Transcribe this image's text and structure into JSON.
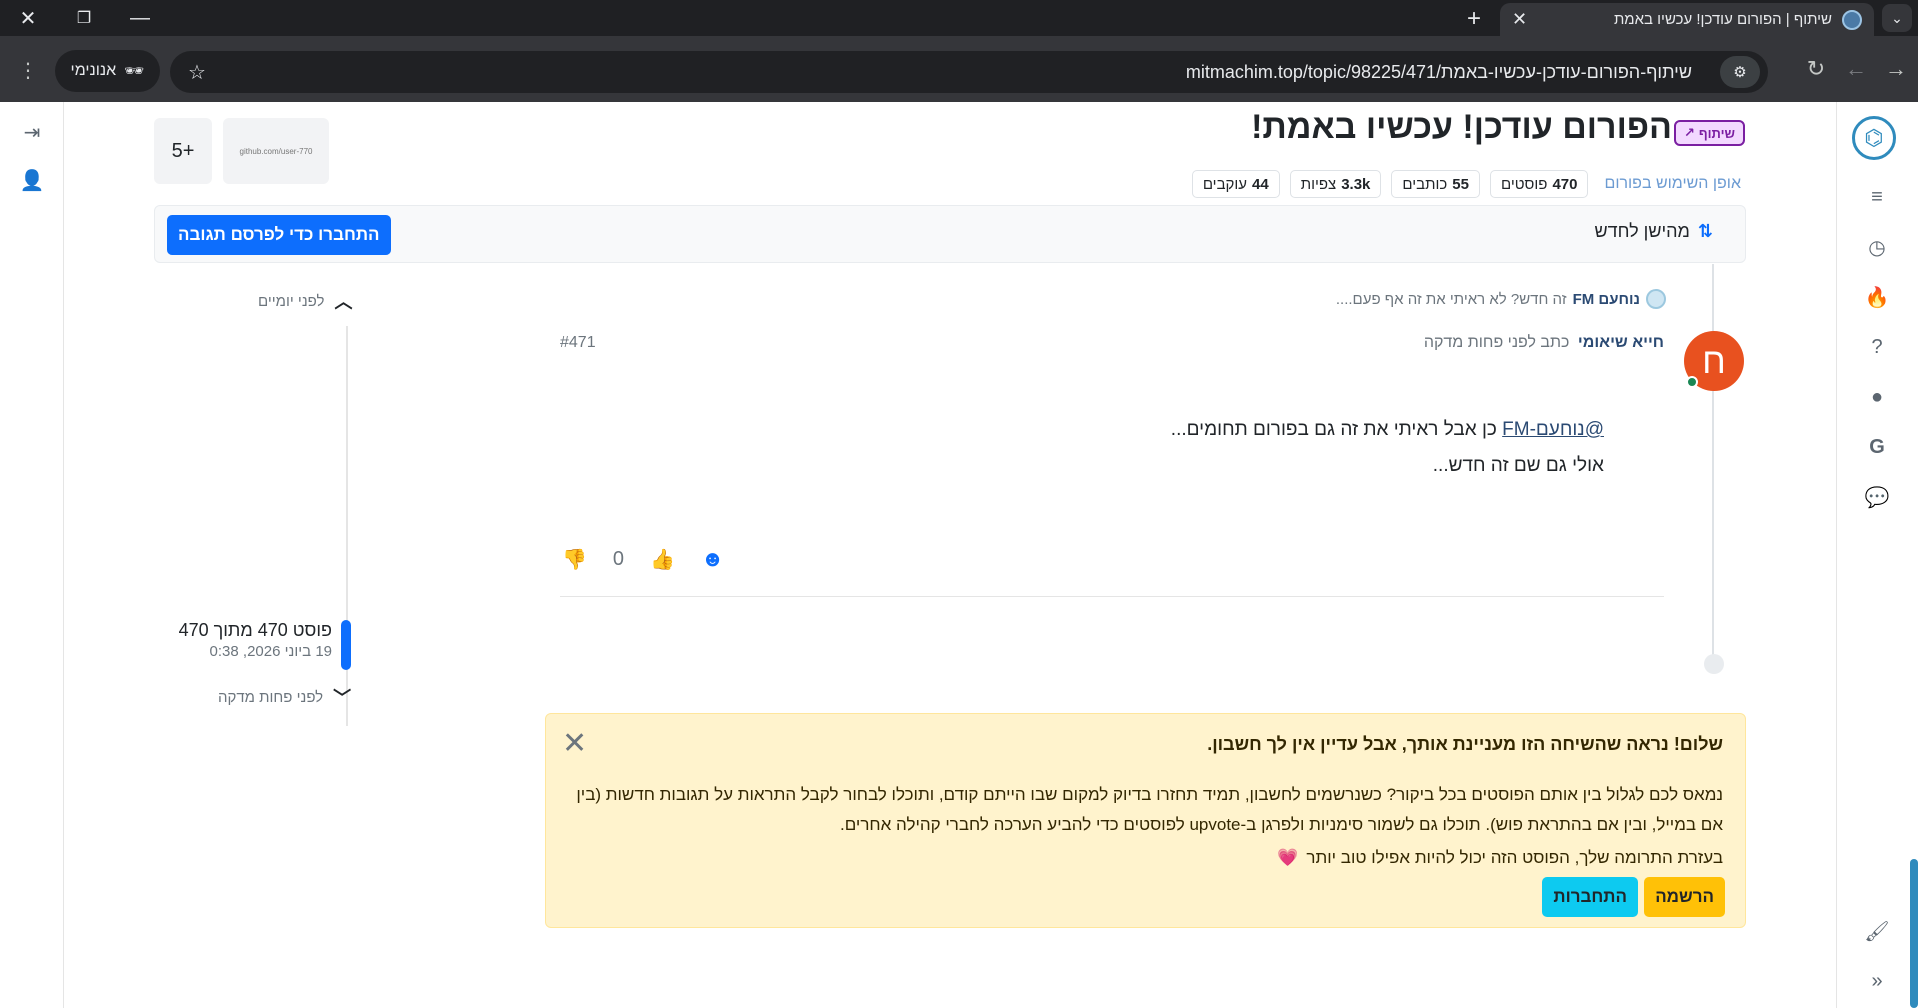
{
  "browser": {
    "tab_title": "שיתוף | הפורום עודכן! עכשיו באמת",
    "url": "mitmachim.top/topic/98225/471/שיתוף-הפורום-עודכן-עכשיו-באמת",
    "incognito_label": "אנונימי"
  },
  "topic": {
    "category_badge": "שיתוף",
    "title": "הפורום עודכן! עכשיו באמת!",
    "thumb_more": "5+",
    "thumb_caption": "github.com/user-770",
    "usage_link": "אופן השימוש בפורום",
    "stats": [
      {
        "value": "470",
        "label": "פוסטים"
      },
      {
        "value": "55",
        "label": "כותבים"
      },
      {
        "value": "3.3k",
        "label": "צפיות"
      },
      {
        "value": "44",
        "label": "עוקבים"
      }
    ]
  },
  "sortbar": {
    "sort_label": "מהישן לחדש",
    "reply_button": "התחברו כדי לפרסם תגובה"
  },
  "post": {
    "parent_name": "נוחעם FM",
    "parent_excerpt": "זה חדש? לא ראיתי את זה אף פעם....",
    "avatar_letter": "ח",
    "author": "חייא שיאומי",
    "meta": "כתב לפני פחות מדקה",
    "number": "#471",
    "mention": "@נוחעם-FM",
    "line1_rest": " כן אבל ראיתי את זה גם בפורום תחומים...",
    "line2": "אולי גם שם זה חדש...",
    "vote_count": "0"
  },
  "timeline": {
    "top_label": "לפני יומיים",
    "current": "פוסט 470 מתוך 470",
    "date": "19 ביוני 2026, 0:38",
    "bottom_label": "לפני פחות מדקה"
  },
  "banner": {
    "title": "שלום! נראה שהשיחה הזו מעניינת אותך, אבל עדיין אין לך חשבון.",
    "body": "נמאס לכם לגלול בין אותם הפוסטים בכל ביקור? כשנרשמים לחשבון, תמיד תחזרו בדיוק למקום שבו הייתם קודם, ותוכלו לבחור לקבל התראות על תגובות חדשות (בין אם במייל, ובין אם בהתראת פוש). תוכלו גם לשמור סימניות ולפרגן ב-upvote לפוסטים כדי להביע הערכה לחברי קהילה אחרים.",
    "body2": "בעזרת התרומה שלך, הפוסט הזה יכול להיות אפילו טוב יותר",
    "signup": "הרשמה",
    "login": "התחברות"
  },
  "icons": {
    "accent": "#0d6efd",
    "avatar_color": "#e8511f",
    "banner_bg": "#fff3cd"
  }
}
